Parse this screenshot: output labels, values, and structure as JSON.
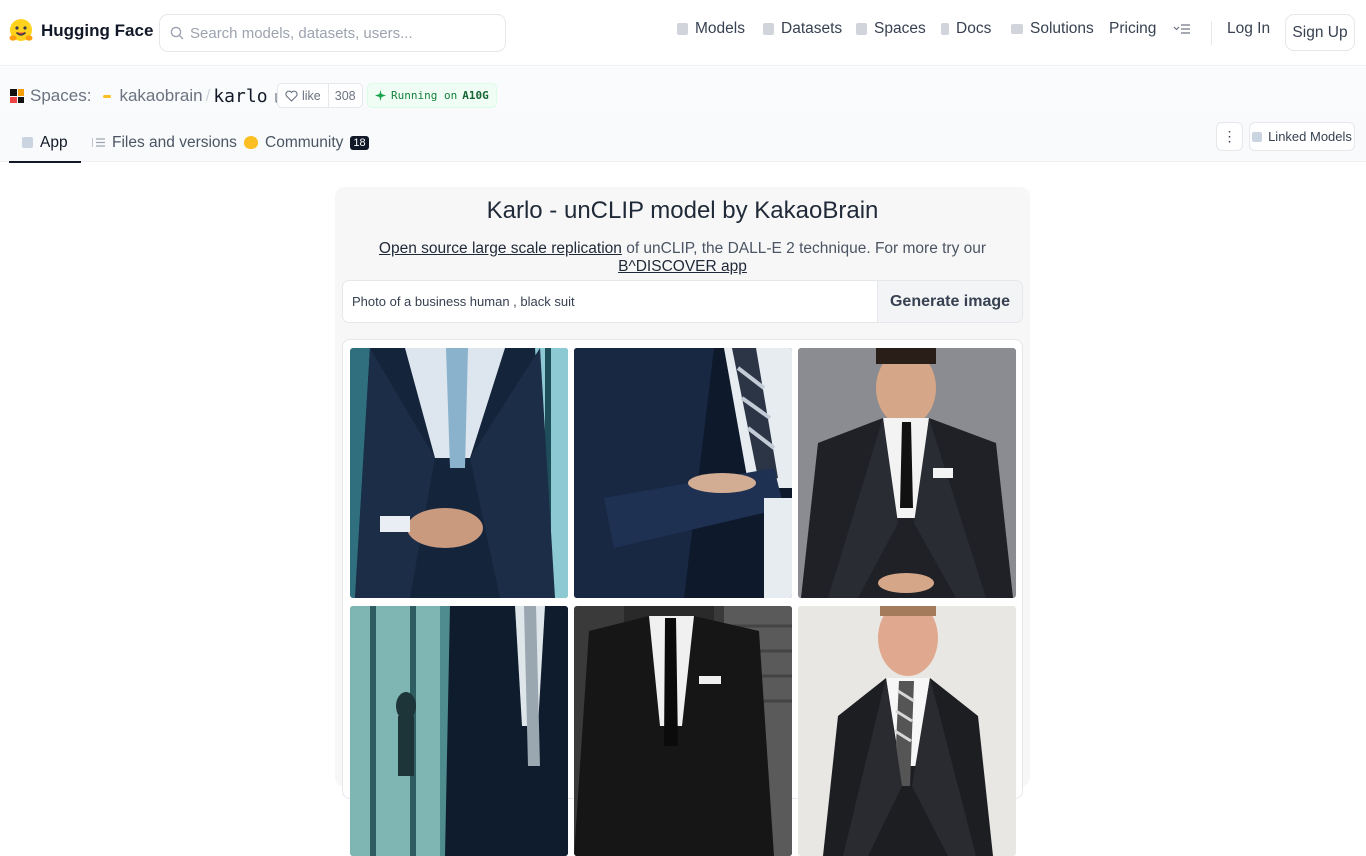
{
  "topnav": {
    "brand_name": "Hugging Face",
    "search_placeholder": "Search models, datasets, users...",
    "links": [
      "Models",
      "Datasets",
      "Spaces",
      "Docs",
      "Solutions",
      "Pricing"
    ],
    "login": "Log In",
    "signup": "Sign Up"
  },
  "space": {
    "section_label": "Spaces:",
    "owner": "kakaobrain",
    "separator": "/",
    "repo": "karlo",
    "like_label": "like",
    "like_count": "308",
    "status_prefix": "Running on",
    "hardware": "A10G",
    "tabs": {
      "app": "App",
      "files": "Files and versions",
      "community": "Community",
      "community_count": "18"
    },
    "more_menu": "⋮",
    "linked_models": "Linked Models"
  },
  "app": {
    "title": "Karlo - unCLIP model by KakaoBrain",
    "desc_link1": "Open source large scale replication",
    "desc_mid": "of unCLIP, the DALL-E 2 technique. For more try our",
    "desc_link2": "B^DISCOVER app",
    "prompt_value": "Photo of a business human , black suit",
    "generate_label": "Generate image"
  },
  "colors": {
    "accent": "#111827",
    "running_green": "#15803d",
    "brand_yellow": "#fbbf24"
  },
  "icons": [
    "hugging-face-logo",
    "search-icon",
    "cube-icon",
    "dataset-icon",
    "spaces-icon",
    "docs-icon",
    "solutions-icon",
    "menu-icon",
    "copy-icon",
    "heart-icon",
    "running-icon",
    "files-icon",
    "community-icon",
    "kebab-icon"
  ]
}
